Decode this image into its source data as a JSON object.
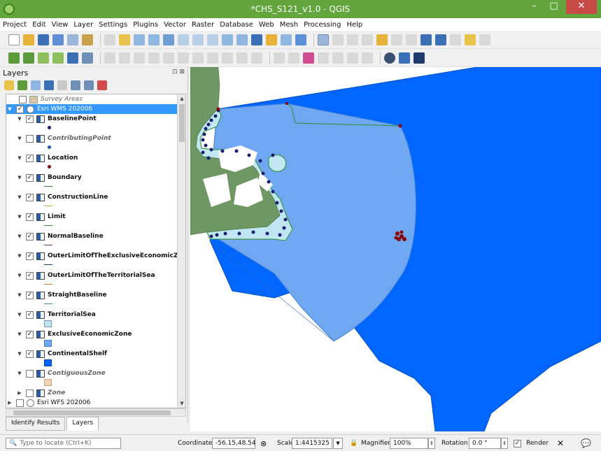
{
  "window": {
    "title": "*CHS_S121_v1.0 - QGIS",
    "minimize": "–",
    "maximize": "□",
    "close": "✕"
  },
  "menu": [
    "Project",
    "Edit",
    "View",
    "Layer",
    "Settings",
    "Plugins",
    "Vector",
    "Raster",
    "Database",
    "Web",
    "Mesh",
    "Processing",
    "Help"
  ],
  "panel": {
    "title": "Layers",
    "controls": "⊡ ⊠"
  },
  "tree": [
    {
      "label": "Survey Areas",
      "checked": false,
      "style": "italic",
      "symbol": "fill-tan",
      "symbol_color": "#d7c8a4"
    },
    {
      "label": "Esri WMS 202006",
      "checked": true,
      "selected": true,
      "group": true
    },
    {
      "label": "BaselinePoint",
      "checked": true,
      "style": "bold",
      "symbol": "point",
      "symbol_color": "#1a1f6e"
    },
    {
      "label": "ContributingPoint",
      "checked": false,
      "style": "italic-bold",
      "symbol": "point",
      "symbol_color": "#1f5aa6"
    },
    {
      "label": "Location",
      "checked": true,
      "style": "bold",
      "symbol": "point",
      "symbol_color": "#7a1010"
    },
    {
      "label": "Boundary",
      "checked": true,
      "style": "bold",
      "symbol": "line",
      "symbol_color": "#2e8b2e"
    },
    {
      "label": "ConstructionLine",
      "checked": true,
      "style": "bold",
      "symbol": "line",
      "symbol_color": "#c8a24a"
    },
    {
      "label": "Limit",
      "checked": true,
      "style": "bold",
      "symbol": "line",
      "symbol_color": "#2e8b2e"
    },
    {
      "label": "NormalBaseline",
      "checked": true,
      "style": "bold",
      "symbol": "line",
      "symbol_color": "#8b2e8b"
    },
    {
      "label": "OuterLimitOfTheExclusiveEconomicZon",
      "checked": true,
      "style": "bold",
      "symbol": "line",
      "symbol_color": "#1a3a8b"
    },
    {
      "label": "OuterLimitOfTheTerritorialSea",
      "checked": true,
      "style": "bold",
      "symbol": "line",
      "symbol_color": "#c87a2e"
    },
    {
      "label": "StraightBaseline",
      "checked": true,
      "style": "bold",
      "symbol": "line",
      "symbol_color": "#2e8bc8"
    },
    {
      "label": "TerritorialSea",
      "checked": true,
      "style": "bold",
      "symbol": "fill",
      "symbol_color": "#bfe6f2"
    },
    {
      "label": "ExclusiveEconomicZone",
      "checked": true,
      "style": "bold",
      "symbol": "fill",
      "symbol_color": "#6fa8f0"
    },
    {
      "label": "ContinentalShelf",
      "checked": true,
      "style": "bold",
      "symbol": "fill",
      "symbol_color": "#0066ff"
    },
    {
      "label": "ContiguousZone",
      "checked": false,
      "style": "italic-bold",
      "symbol": "fill",
      "symbol_color": "#f2d3b4"
    },
    {
      "label": "Zone",
      "checked": false,
      "style": "italic-bold",
      "symbol": "none"
    },
    {
      "label": "Esri WFS 202006",
      "checked": false,
      "group": true
    }
  ],
  "tabs": [
    "Identify Results",
    "Layers"
  ],
  "status": {
    "locate_placeholder": "Type to locate (Ctrl+K)",
    "coordinate_label": "Coordinate",
    "coordinate_value": "-56.15,48.54",
    "scale_label": "Scale",
    "scale_value": "1:4415325",
    "magnifier_label": "Magnifier",
    "magnifier_value": "100%",
    "rotation_label": "Rotation",
    "rotation_value": "0.0 °",
    "render_label": "Render",
    "render_checked": true
  },
  "colors": {
    "title_bar": "#62a63d",
    "continental_shelf": "#0066ff",
    "eez": "#6fa8f0",
    "territorial_sea": "#bfe6f2",
    "land": "#6e9763",
    "baseline_points": "#1a1f6e",
    "location_points": "#8b0000"
  },
  "icons": {
    "app": "qgis-logo-icon",
    "search": "magnifier-icon",
    "lock": "lock-icon",
    "no_edit": "pencil-cross-icon",
    "messages": "speech-bubble-icon"
  }
}
